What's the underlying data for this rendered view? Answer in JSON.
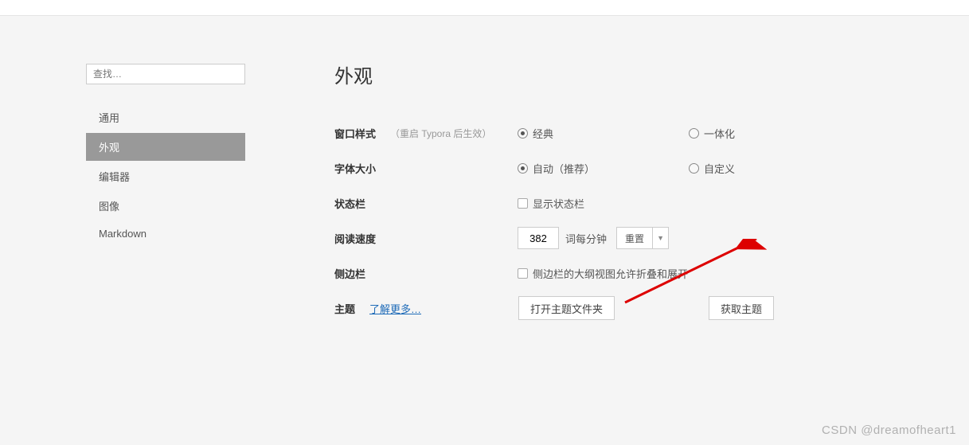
{
  "search": {
    "placeholder": "查找…"
  },
  "nav": {
    "items": [
      {
        "label": "通用",
        "active": false
      },
      {
        "label": "外观",
        "active": true
      },
      {
        "label": "编辑器",
        "active": false
      },
      {
        "label": "图像",
        "active": false
      },
      {
        "label": "Markdown",
        "active": false
      }
    ]
  },
  "main": {
    "title": "外观",
    "window_style": {
      "label": "窗口样式",
      "hint": "（重启 Typora 后生效）",
      "opt1": "经典",
      "opt2": "一体化"
    },
    "font_size": {
      "label": "字体大小",
      "opt1": "自动（推荐）",
      "opt2": "自定义"
    },
    "status_bar": {
      "label": "状态栏",
      "opt": "显示状态栏"
    },
    "reading_speed": {
      "label": "阅读速度",
      "value": "382",
      "unit": "词每分钟",
      "reset": "重置",
      "drop": "▼"
    },
    "sidebar": {
      "label": "侧边栏",
      "opt": "侧边栏的大纲视图允许折叠和展开"
    },
    "theme": {
      "label": "主题",
      "link": "了解更多…",
      "open_folder": "打开主题文件夹",
      "get_theme": "获取主题"
    }
  },
  "watermark": "CSDN @dreamofheart1"
}
